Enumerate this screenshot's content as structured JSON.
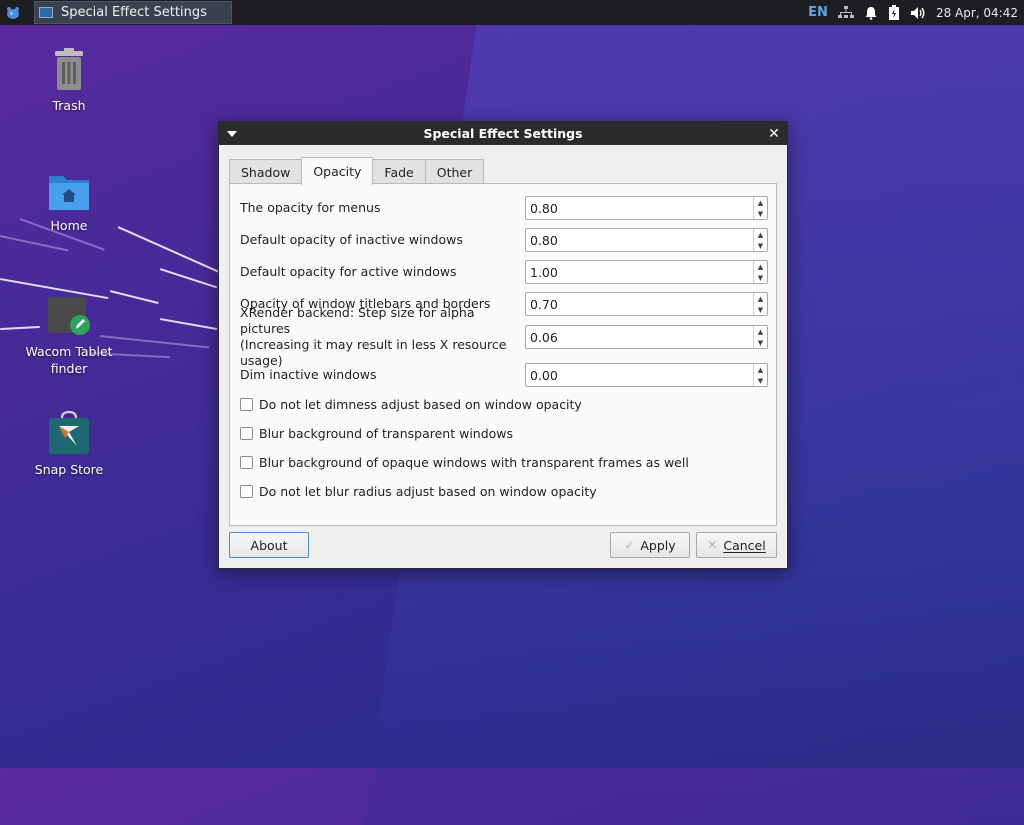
{
  "panel": {
    "task_title": "Special Effect Settings",
    "keyboard_layout": "EN",
    "clock": "28 Apr, 04:42"
  },
  "desktop": {
    "icons": [
      {
        "label": "Trash"
      },
      {
        "label": "Home"
      },
      {
        "label": "Wacom Tablet finder"
      },
      {
        "label": "Snap Store"
      }
    ]
  },
  "dialog": {
    "title": "Special Effect Settings",
    "tabs": [
      {
        "label": "Shadow",
        "active": false
      },
      {
        "label": "Opacity",
        "active": true
      },
      {
        "label": "Fade",
        "active": false
      },
      {
        "label": "Other",
        "active": false
      }
    ],
    "settings": [
      {
        "label": "The opacity for menus",
        "value": "0.80"
      },
      {
        "label": "Default opacity of inactive windows",
        "value": "0.80"
      },
      {
        "label": "Default opacity for active windows",
        "value": "1.00"
      },
      {
        "label": "Opacity of window titlebars and borders",
        "value": "0.70"
      },
      {
        "label": "XRender backend: Step size for alpha pictures\n(Increasing it may result in less X resource usage)",
        "value": "0.06"
      },
      {
        "label": "Dim inactive windows",
        "value": "0.00"
      }
    ],
    "checkboxes": [
      {
        "label": "Do not let dimness adjust based on window opacity",
        "checked": false
      },
      {
        "label": "Blur background of transparent windows",
        "checked": false
      },
      {
        "label": "Blur background of opaque windows with transparent frames as well",
        "checked": false
      },
      {
        "label": "Do not let blur radius adjust based on window opacity",
        "checked": false
      }
    ],
    "buttons": {
      "about": "About",
      "apply": "Apply",
      "cancel": "Cancel"
    }
  }
}
